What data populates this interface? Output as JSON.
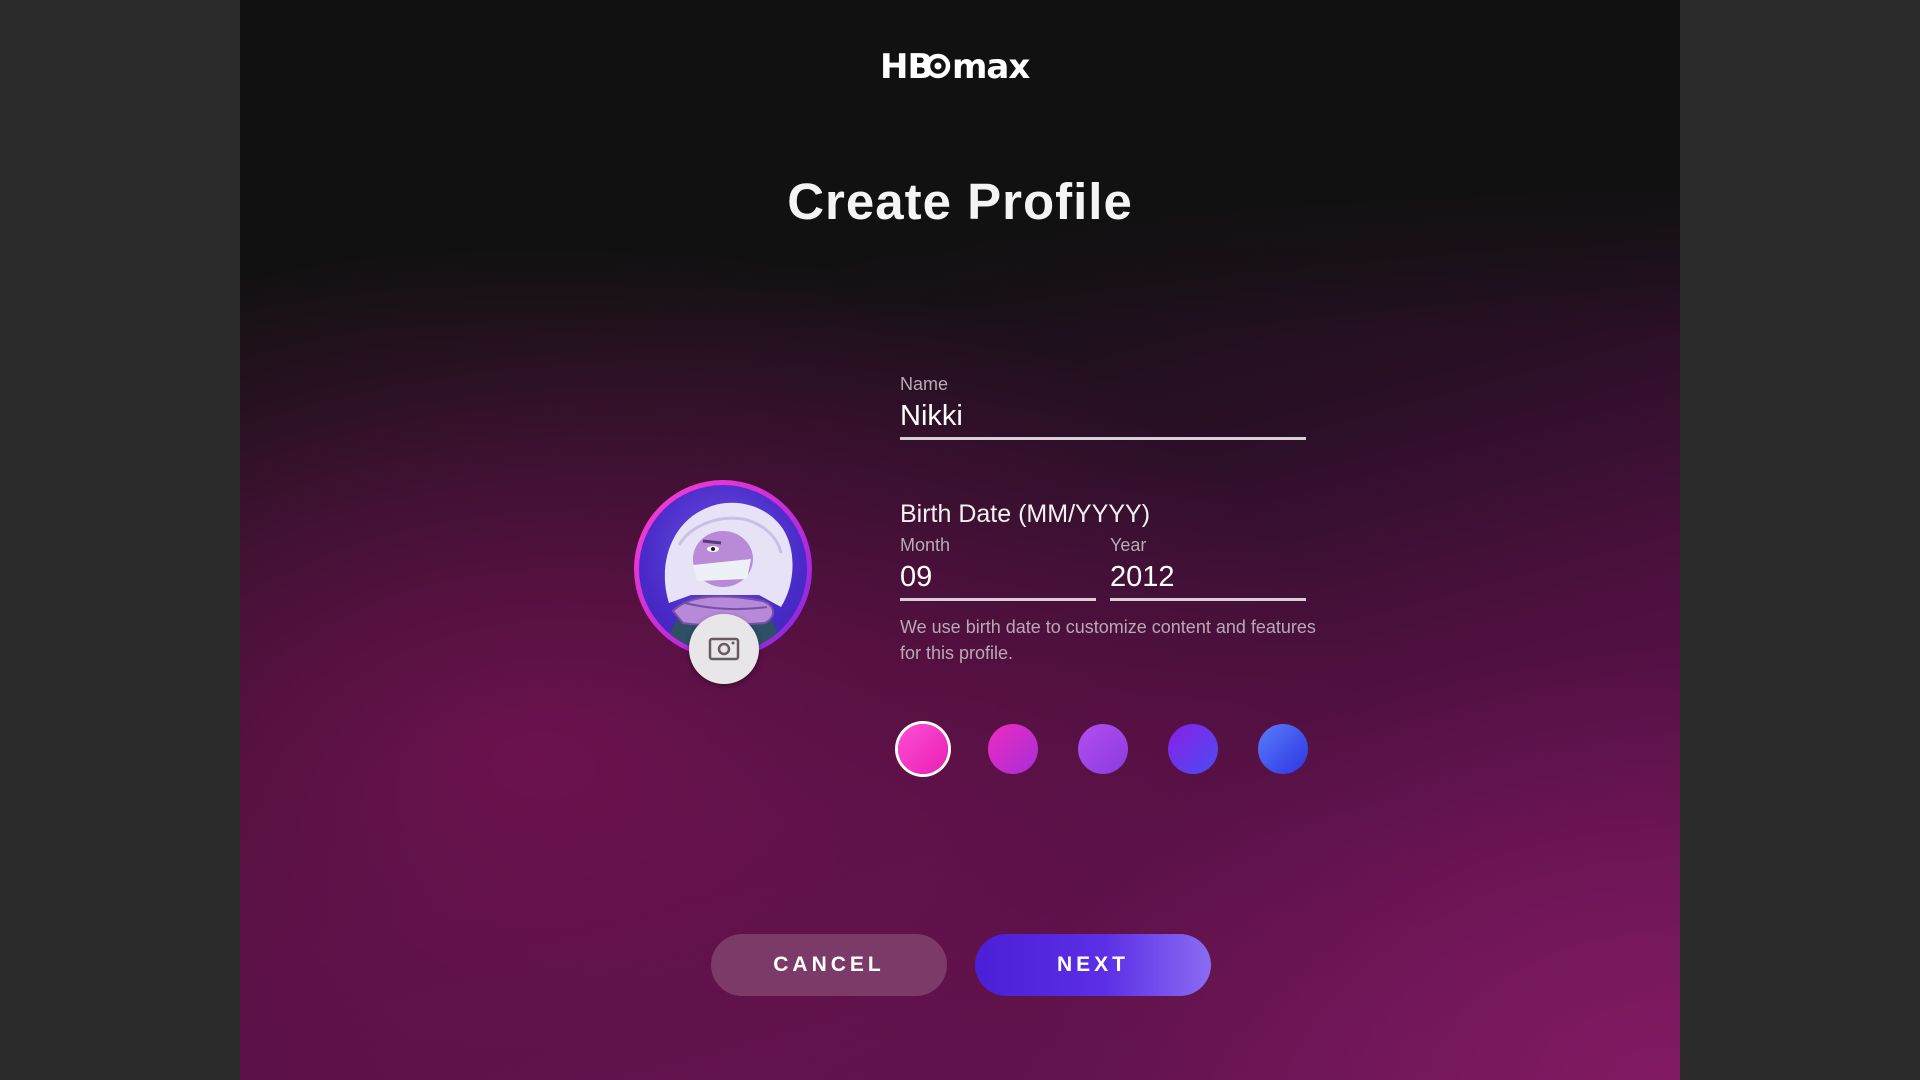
{
  "header": {
    "logo_text": "HBOmax",
    "title": "Create Profile"
  },
  "avatar": {
    "character": "cartoon-avatar",
    "ring_color": "#ff3fd0"
  },
  "name_field": {
    "label": "Name",
    "value": "Nikki"
  },
  "birth_date": {
    "label": "Birth Date (MM/YYYY)",
    "month_label": "Month",
    "month_value": "09",
    "year_label": "Year",
    "year_value": "2012",
    "hint": "We use birth date to customize content and features for this profile."
  },
  "color_swatches": [
    {
      "id": "pink",
      "colors": [
        "#ff4fd6",
        "#e81fb4"
      ],
      "selected": true
    },
    {
      "id": "magenta",
      "colors": [
        "#f02ac0",
        "#a52fd8"
      ],
      "selected": false
    },
    {
      "id": "violet",
      "colors": [
        "#b24ff0",
        "#8a3adf"
      ],
      "selected": false
    },
    {
      "id": "indigo",
      "colors": [
        "#8a1fe6",
        "#4a4cf2"
      ],
      "selected": false
    },
    {
      "id": "blue",
      "colors": [
        "#5a7cff",
        "#2d34e0"
      ],
      "selected": false
    }
  ],
  "buttons": {
    "cancel_label": "CANCEL",
    "next_label": "NEXT"
  }
}
